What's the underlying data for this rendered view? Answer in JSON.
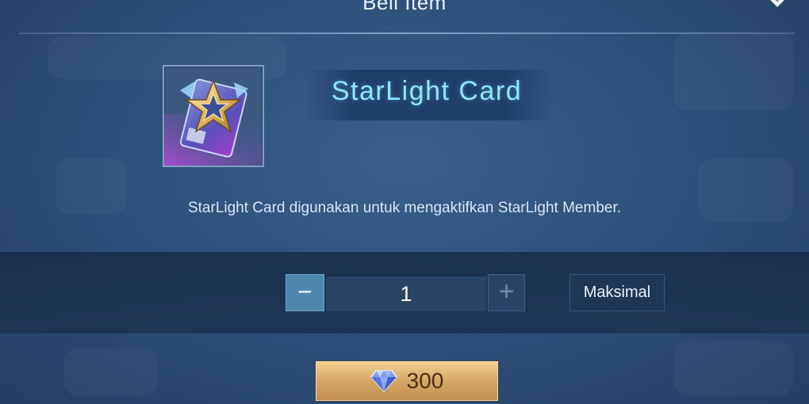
{
  "dialog": {
    "title": "Beli Item"
  },
  "item": {
    "name": "StarLight Card",
    "description": "StarLight Card digunakan untuk mengaktifkan StarLight Member.",
    "icon": "starlight-card-icon"
  },
  "quantity": {
    "value": "1",
    "max_label": "Maksimal"
  },
  "purchase": {
    "price": "300",
    "currency_icon": "diamond-icon"
  },
  "colors": {
    "accent_cyan": "#8fe6ff",
    "gold_button": "#d5a865",
    "background": "#2d4e78"
  }
}
